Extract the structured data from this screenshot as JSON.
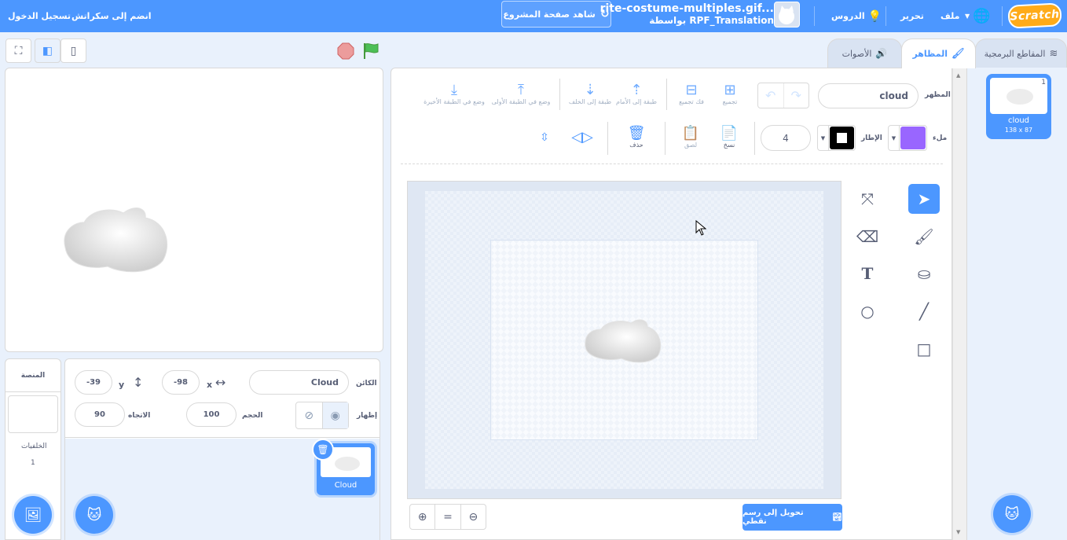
{
  "menubar": {
    "logo": "Scratch",
    "file": "ملف",
    "edit": "تحرير",
    "tutorials": "الدروس",
    "project_title": "rite-costume-multiples.gif...",
    "project_author": "بواسطة RPF_Translation",
    "see_project_page": "شاهد صفحة المشروع",
    "join": "انضم إلى سكراتش",
    "sign_in": "تسجيل الدخول"
  },
  "tabs": {
    "code": "المقاطع البرمجية",
    "costumes": "المظاهر",
    "sounds": "الأصوات"
  },
  "costume_list": {
    "items": [
      {
        "index": "1",
        "name": "cloud",
        "size": "138 x 87"
      }
    ]
  },
  "paint_editor": {
    "costume_label": "المظهر",
    "costume_name": "cloud",
    "group": "تجميع",
    "ungroup": "فك تجميع",
    "forward": "طبقة إلى الأمام",
    "backward": "طبقة إلى الخلف",
    "front": "وضع في الطبقة الأولى",
    "back": "وضع في الطبقة الأخيرة",
    "fill_label": "ملء",
    "fill_color": "#9966ff",
    "outline_label": "الإطار",
    "outline_color": "#000000",
    "outline_width": "4",
    "copy": "نسخ",
    "paste": "لصق",
    "delete": "حذف",
    "convert_button": "تحويل إلى رسم نقطي",
    "zoom_in": "+",
    "zoom_reset": "=",
    "zoom_out": "−"
  },
  "sprite_info": {
    "sprite_label": "الكائن",
    "sprite_name": "Cloud",
    "x_label": "x",
    "x_value": "-98",
    "y_label": "y",
    "y_value": "-39",
    "show_label": "إظهار",
    "size_label": "الحجم",
    "size_value": "100",
    "direction_label": "الاتجاه",
    "direction_value": "90"
  },
  "sprites": [
    {
      "name": "Cloud"
    }
  ],
  "stage_panel": {
    "title": "المنصة",
    "backdrops_label": "الخلفيات",
    "backdrops_count": "1"
  },
  "colors": {
    "accent": "#4c97ff",
    "logo": "#ffab19"
  }
}
